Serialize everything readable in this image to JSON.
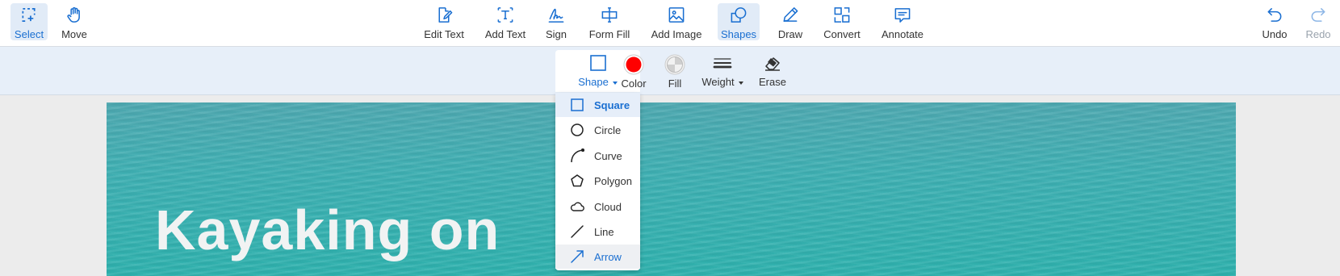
{
  "toolbar": {
    "left": [
      {
        "label": "Select",
        "icon": "select-icon",
        "active": true
      },
      {
        "label": "Move",
        "icon": "hand-icon"
      }
    ],
    "center": [
      {
        "label": "Edit Text",
        "icon": "edit-text-icon"
      },
      {
        "label": "Add Text",
        "icon": "add-text-icon"
      },
      {
        "label": "Sign",
        "icon": "signature-icon"
      },
      {
        "label": "Form Fill",
        "icon": "form-fill-icon"
      },
      {
        "label": "Add Image",
        "icon": "image-icon"
      },
      {
        "label": "Shapes",
        "icon": "shapes-icon",
        "active": true
      },
      {
        "label": "Draw",
        "icon": "pencil-icon"
      },
      {
        "label": "Convert",
        "icon": "convert-icon"
      },
      {
        "label": "Annotate",
        "icon": "comment-icon"
      }
    ],
    "right": [
      {
        "label": "Undo",
        "icon": "undo-icon"
      },
      {
        "label": "Redo",
        "icon": "redo-icon",
        "disabled": true
      }
    ]
  },
  "subtoolbar": {
    "shape_label": "Shape",
    "color_label": "Color",
    "fill_label": "Fill",
    "weight_label": "Weight",
    "erase_label": "Erase",
    "color_value": "#ff0000"
  },
  "dropdown": {
    "options": [
      {
        "label": "Square",
        "icon": "square-icon",
        "selected": true
      },
      {
        "label": "Circle",
        "icon": "circle-icon"
      },
      {
        "label": "Curve",
        "icon": "curve-icon"
      },
      {
        "label": "Polygon",
        "icon": "polygon-icon"
      },
      {
        "label": "Cloud",
        "icon": "cloud-icon"
      },
      {
        "label": "Line",
        "icon": "line-icon"
      },
      {
        "label": "Arrow",
        "icon": "arrow-icon",
        "hovered": true
      }
    ]
  },
  "document": {
    "heading": "Kayaking on"
  },
  "colors": {
    "accent": "#1a6fd1",
    "active_bg": "#e1ebf7",
    "subbar_bg": "#e7eff9"
  }
}
